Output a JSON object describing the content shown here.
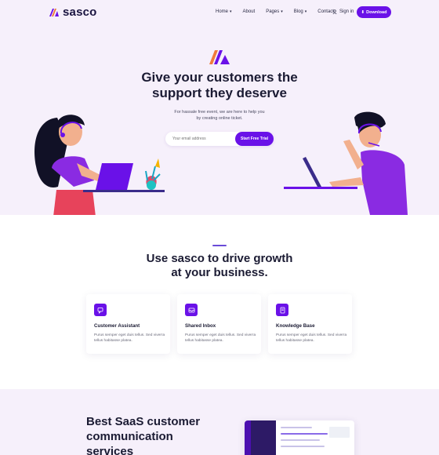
{
  "brand": {
    "name": "sasco"
  },
  "nav": {
    "items": [
      {
        "label": "Home",
        "dropdown": true
      },
      {
        "label": "About",
        "dropdown": false
      },
      {
        "label": "Pages",
        "dropdown": true
      },
      {
        "label": "Blog",
        "dropdown": true
      },
      {
        "label": "Contact",
        "dropdown": false
      }
    ],
    "signin": "Sign in",
    "download": "Download"
  },
  "hero": {
    "title_line1": "Give your customers the",
    "title_line2": "support they deserve",
    "subtitle_line1": "For hassale free event, we are here to help you",
    "subtitle_line2": "by creating online ticket.",
    "email_placeholder": "Your email address",
    "cta": "Start Free Trial"
  },
  "features": {
    "title_line1": "Use sasco to drive growth",
    "title_line2": "at your business.",
    "cards": [
      {
        "title": "Customer Assistant",
        "desc": "Purus semper eget duis tellus. Sed viverra tellus habitasse platea.",
        "icon": "chat-icon"
      },
      {
        "title": "Shared Inbox",
        "desc": "Purus semper eget duis tellus. Sed viverra tellus habitasse platea.",
        "icon": "inbox-icon"
      },
      {
        "title": "Knowledge Base",
        "desc": "Purus semper eget duis tellus. Sed viverra tellus habitasse platea.",
        "icon": "book-icon"
      }
    ]
  },
  "bottom": {
    "title_line1": "Best SaaS customer",
    "title_line2": "communication",
    "title_line3": "services"
  },
  "colors": {
    "accent": "#6a11e8",
    "hero_bg": "#f6f0fb",
    "heading": "#1b1b33",
    "logo_orange": "#f07a3b"
  }
}
